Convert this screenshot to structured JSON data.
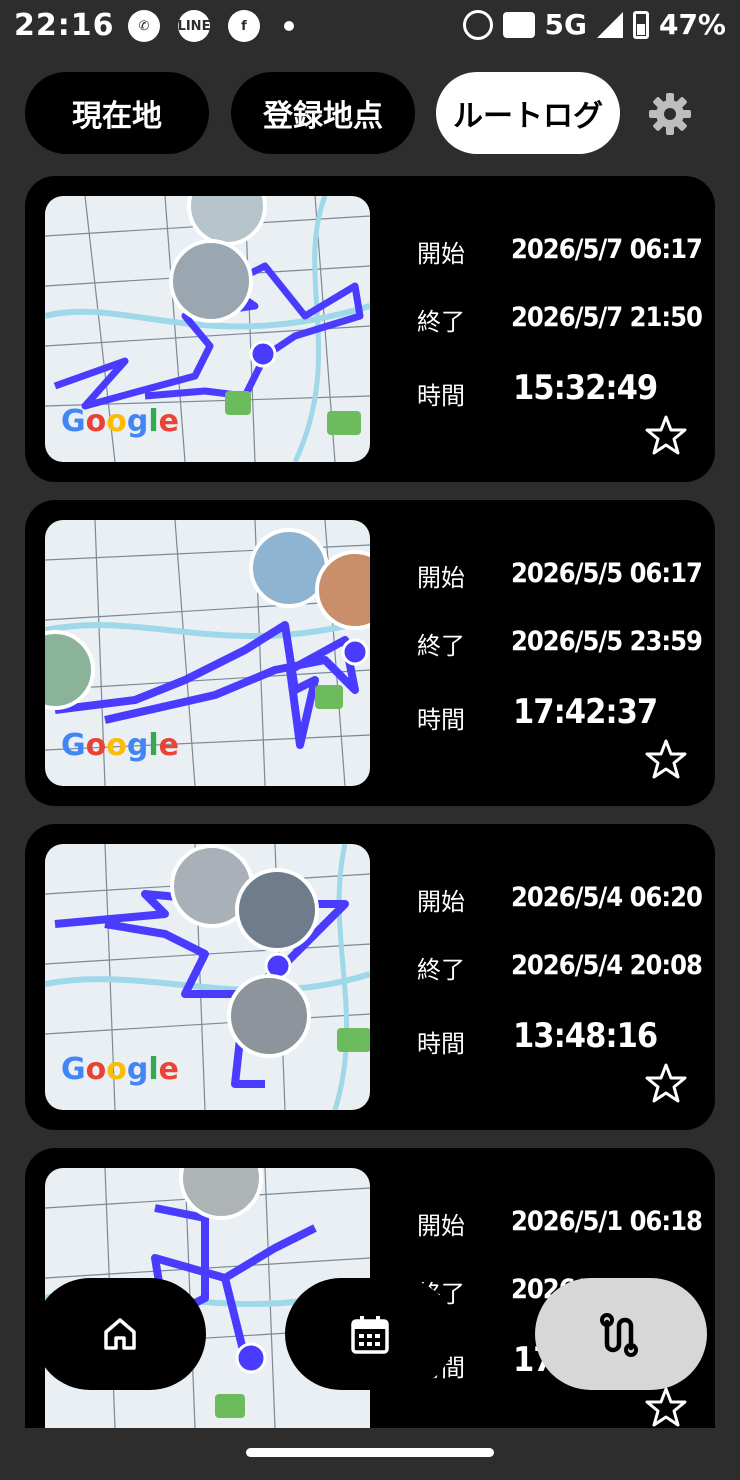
{
  "status_bar": {
    "time": "22:16",
    "apps": [
      "whatsapp-icon",
      "line-icon",
      "facebook-icon"
    ],
    "network": "5G",
    "battery": "47%"
  },
  "tabs": [
    {
      "label": "現在地",
      "active": false
    },
    {
      "label": "登録地点",
      "active": false
    },
    {
      "label": "ルートログ",
      "active": true
    }
  ],
  "labels": {
    "start": "開始",
    "end": "終了",
    "duration": "時間"
  },
  "map_brand": "Google",
  "logs": [
    {
      "start": "2026/5/7 06:17",
      "end": "2026/5/7 21:50",
      "duration": "15:32:49"
    },
    {
      "start": "2026/5/5 06:17",
      "end": "2026/5/5 23:59",
      "duration": "17:42:37"
    },
    {
      "start": "2026/5/4 06:20",
      "end": "2026/5/4 20:08",
      "duration": "13:48:16"
    },
    {
      "start": "2026/5/1 06:18",
      "end": "2026/5/1 ",
      "duration": "17"
    }
  ],
  "colors": {
    "route": "#4a3cff",
    "accent": "#ffffff",
    "card": "#000000",
    "background": "#2d2d2d"
  }
}
